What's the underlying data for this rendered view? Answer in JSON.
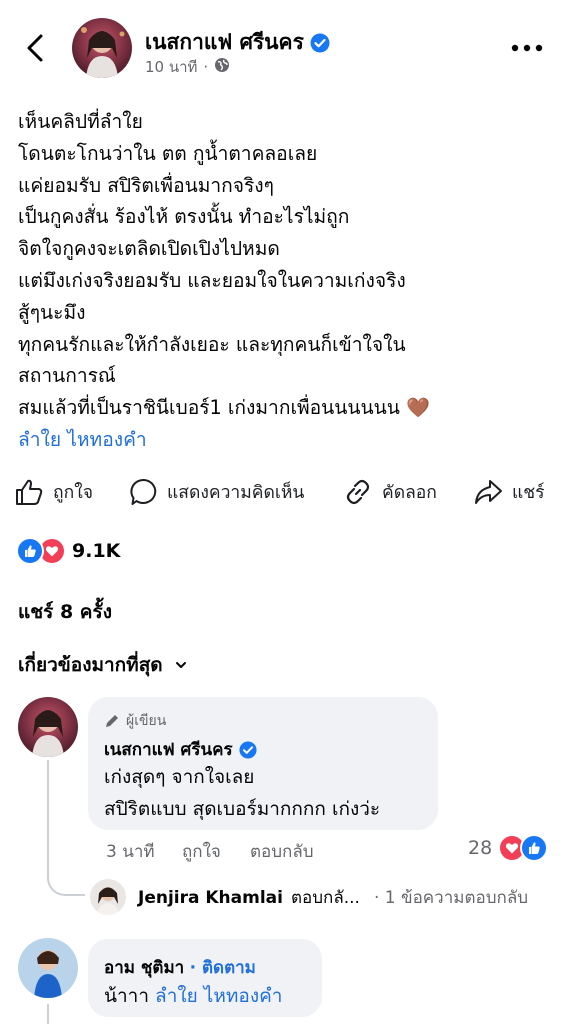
{
  "header": {
    "author": "เนสกาแฟ ศรีนคร",
    "time": "10 นาที",
    "dot": "·"
  },
  "post": {
    "lines": [
      "เห็นคลิปที่ลำใย",
      "โดนตะโกนว่าใน ตต กูน้ำตาคลอเลย",
      "แค่ยอมรับ สปิริตเพื่อนมากจริงๆ",
      "เป็นกูคงสั่น ร้องไห้ ตรงนั้น ทำอะไรไม่ถูก",
      "จิตใจกูคงจะเตลิดเปิดเปิงไปหมด",
      "แต่มึงเก่งจริงยอมรับ และยอมใจในความเก่งจริง",
      "สู้ๆนะมึง",
      "ทุกคนรักและให้กำลังเยอะ และทุกคนก็เข้าใจใน",
      "สถานการณ์",
      "สมแล้วที่เป็นราชินีเบอร์1 เก่งมากเพื่อนนนนนน"
    ],
    "emoji": "🤎",
    "mention": "ลำใย ไหทองคำ"
  },
  "actions": {
    "like": "ถูกใจ",
    "comment": "แสดงความคิดเห็น",
    "copy": "คัดลอก",
    "share": "แชร์"
  },
  "reactions": {
    "count": "9.1K",
    "colors": {
      "like": "#1877f2",
      "love": "#f33e58"
    }
  },
  "shares": "แชร์ 8 ครั้ง",
  "sort": {
    "label": "เกี่ยวข้องมากที่สุด"
  },
  "comments": [
    {
      "badge": "ผู้เขียน",
      "name": "เนสกาแฟ ศรีนคร",
      "lines": [
        "เก่งสุดๆ จากใจเลย",
        "สปิริตแบบ สุดเบอร์มากกกก เก่งว่ะ"
      ],
      "time": "3 นาที",
      "like": "ถูกใจ",
      "reply": "ตอบกลับ",
      "reaction_count": "28",
      "reply_summary": {
        "name": "Jenjira Khamlai",
        "action": "ตอบกลั...",
        "count": "· 1 ข้อความตอบกลับ"
      }
    },
    {
      "name": "อาม ชุติมา",
      "follow": "· ติดตาม",
      "prefix": "น้าาา",
      "mention": "ลำใย ไหทองคำ"
    }
  ],
  "colors": {
    "accent": "#216fdb",
    "verified": "#1877f2",
    "secondary": "#65676b",
    "bubble": "#f0f2f5"
  }
}
